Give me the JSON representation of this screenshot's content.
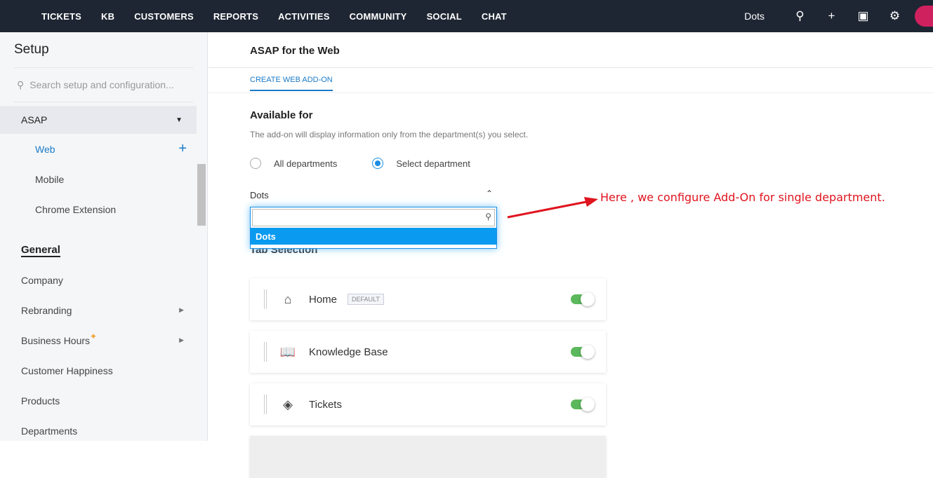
{
  "nav": [
    "TICKETS",
    "KB",
    "CUSTOMERS",
    "REPORTS",
    "ACTIVITIES",
    "COMMUNITY",
    "SOCIAL",
    "CHAT"
  ],
  "org": "Dots",
  "sidebar": {
    "title": "Setup",
    "search_placeholder": "Search setup and configuration...",
    "group": "ASAP",
    "sub": [
      {
        "label": "Web"
      },
      {
        "label": "Mobile"
      },
      {
        "label": "Chrome Extension"
      }
    ],
    "section": "General",
    "items": [
      "Company",
      "Rebranding",
      "Business Hours",
      "Customer Happiness",
      "Products",
      "Departments"
    ]
  },
  "page": {
    "title": "ASAP for the Web",
    "tab": "CREATE WEB ADD-ON",
    "available": "Available for",
    "desc": "The add-on will display information only from the department(s) you select.",
    "radio_all": "All departments",
    "radio_select": "Select department",
    "dept_value": "Dots",
    "option": "Dots",
    "tab_selection": "Tab Selection",
    "cards": [
      {
        "label": "Home",
        "badge": "DEFAULT",
        "enabled": true
      },
      {
        "label": "Knowledge Base",
        "enabled": true
      },
      {
        "label": "Tickets",
        "enabled": true
      }
    ]
  },
  "annotation": "Here , we configure Add-On for single department.",
  "colors": {
    "accent": "#1a7bc7",
    "topbar": "#1f2633",
    "toggle": "#5cb85c",
    "annotation": "#e0141e"
  }
}
